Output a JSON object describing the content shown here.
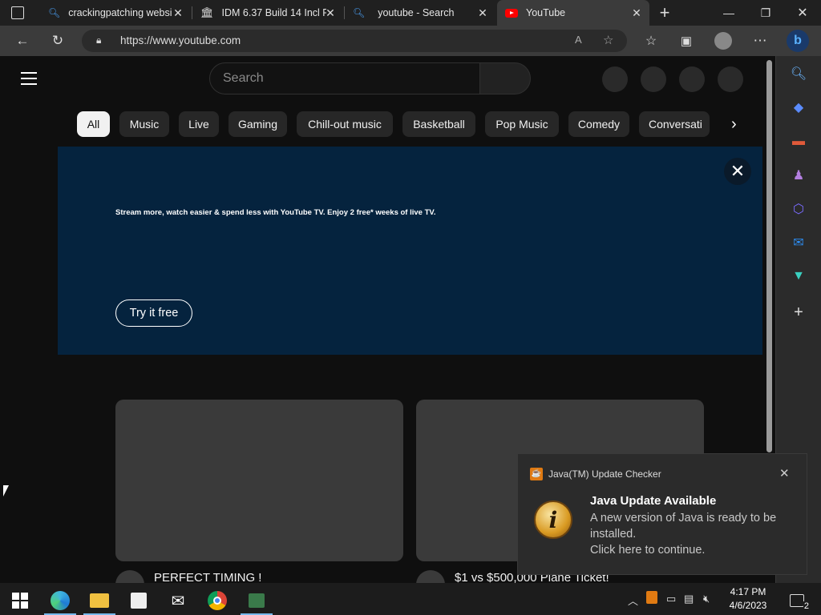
{
  "tabs": [
    {
      "title": "crackingpatching websi",
      "icon": "search-icon"
    },
    {
      "title": "IDM 6.37 Build 14 Incl P",
      "icon": "bank-icon"
    },
    {
      "title": "youtube - Search",
      "icon": "search-icon"
    },
    {
      "title": "YouTube",
      "icon": "youtube-icon"
    }
  ],
  "address": {
    "url": "https://www.youtube.com"
  },
  "youtube": {
    "search_placeholder": "Search",
    "chips": [
      "All",
      "Music",
      "Live",
      "Gaming",
      "Chill-out music",
      "Basketball",
      "Pop Music",
      "Comedy",
      "Conversati"
    ],
    "banner": {
      "text": "Stream more, watch easier & spend less with YouTube TV. Enjoy 2 free* weeks of live TV.",
      "cta": "Try it free"
    },
    "videos": [
      {
        "title": "PERFECT TIMING !"
      },
      {
        "title": "$1 vs $500,000 Plane Ticket!"
      }
    ]
  },
  "toast": {
    "app": "Java(TM) Update Checker",
    "title": "Java Update Available",
    "body_line1": "A new version of Java is ready to be installed.",
    "body_line2": "Click here to continue."
  },
  "taskbar": {
    "time": "4:17 PM",
    "date": "4/6/2023",
    "notification_count": "2"
  },
  "colors": {
    "youtube_bg": "#0f0f0f",
    "banner_bg": "#05233e",
    "accent": "#76b9ed"
  }
}
